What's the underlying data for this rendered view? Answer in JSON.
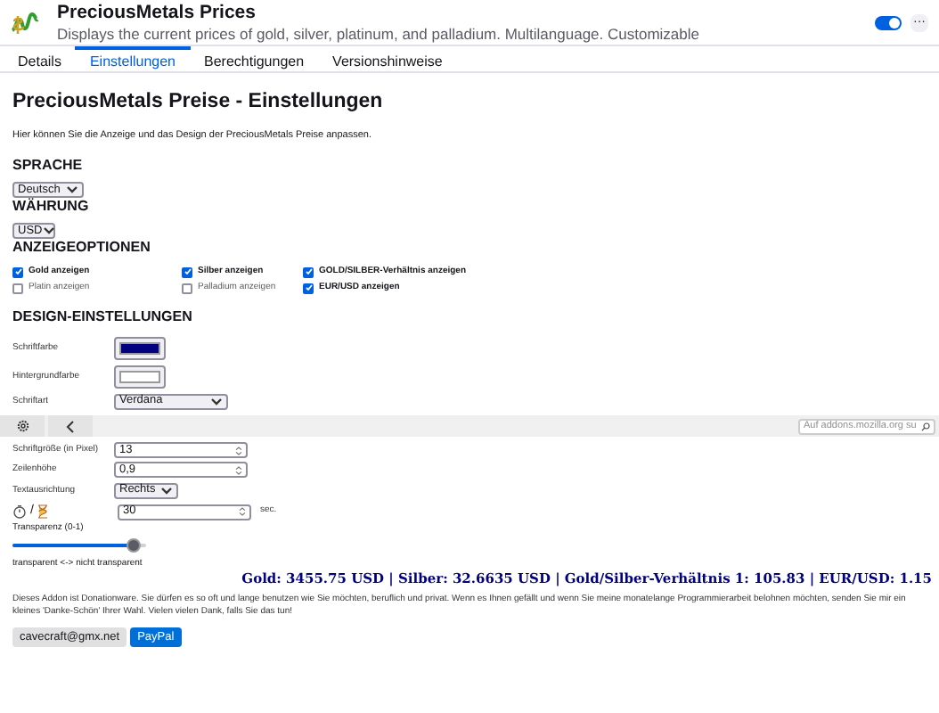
{
  "header": {
    "title": "PreciousMetals Prices",
    "description": "Displays the current prices of gold, silver, platinum, and palladium. Multilanguage. Customizable",
    "enabled": true,
    "more_label": "···"
  },
  "tabs": [
    {
      "label": "Details",
      "selected": false
    },
    {
      "label": "Einstellungen",
      "selected": true
    },
    {
      "label": "Berechtigungen",
      "selected": false
    },
    {
      "label": "Versionshinweise",
      "selected": false
    }
  ],
  "page_title": "PreciousMetals Preise - Einstellungen",
  "intro": "Hier können Sie die Anzeige und das Design der PreciousMetals Preise anpassen.",
  "language": {
    "heading": "SPRACHE",
    "value": "Deutsch"
  },
  "currency": {
    "heading": "WÄHRUNG",
    "value": "USD"
  },
  "display_options": {
    "heading": "ANZEIGEOPTIONEN",
    "items": [
      {
        "label": "Gold anzeigen",
        "checked": true
      },
      {
        "label": "Silber anzeigen",
        "checked": true
      },
      {
        "label": "GOLD/SILBER-Verhältnis anzeigen",
        "checked": true
      },
      {
        "label": "Platin anzeigen",
        "checked": false
      },
      {
        "label": "Palladium anzeigen",
        "checked": false
      },
      {
        "label": "EUR/USD anzeigen",
        "checked": true
      }
    ]
  },
  "design": {
    "heading": "DESIGN-EINSTELLUNGEN",
    "rows": [
      {
        "kind": "color",
        "label": "Schriftfarbe",
        "color": "#000080"
      },
      {
        "kind": "color",
        "label": "Hintergrundfarbe",
        "color": "#ffffff"
      },
      {
        "kind": "select",
        "label": "Schriftart",
        "value": "Verdana",
        "wide": true
      },
      {
        "kind": "toolbar",
        "search_placeholder": "Auf addons.mozilla.org su"
      },
      {
        "kind": "number",
        "label": "Schriftgröße (in Pixel)",
        "value": "13"
      },
      {
        "kind": "number",
        "label": "Zeilenhöhe",
        "value": "0,9"
      },
      {
        "kind": "select",
        "label": "Textausrichtung",
        "value": "Rechts",
        "wide": false
      },
      {
        "kind": "timer",
        "separator": "/",
        "value": "30",
        "unit": "sec."
      },
      {
        "kind": "slider",
        "label": "Transparenz (0-1)",
        "level": 0.9,
        "caption": "transparent <-> nicht transparent"
      }
    ]
  },
  "preview": "Gold: 3455.75 USD | Silber: 32.6635 USD | Gold/Silber-Verhältnis 1: 105.83 | EUR/USD: 1.15",
  "donation": "Dieses Addon ist Donationware. Sie dürfen es so oft und lange benutzen wie Sie möchten, beruflich und privat. Wenn es Ihnen gefällt und wenn Sie meine monatelange Programmierarbeit belohnen möchten, senden Sie mir ein kleines 'Danke-Schön' Ihrer Wahl. Vielen vielen Dank, falls Sie das tun!",
  "buttons": [
    {
      "label": "cavecraft@gmx.net",
      "kind": "email"
    },
    {
      "label": "PayPal",
      "kind": "paypal"
    }
  ]
}
